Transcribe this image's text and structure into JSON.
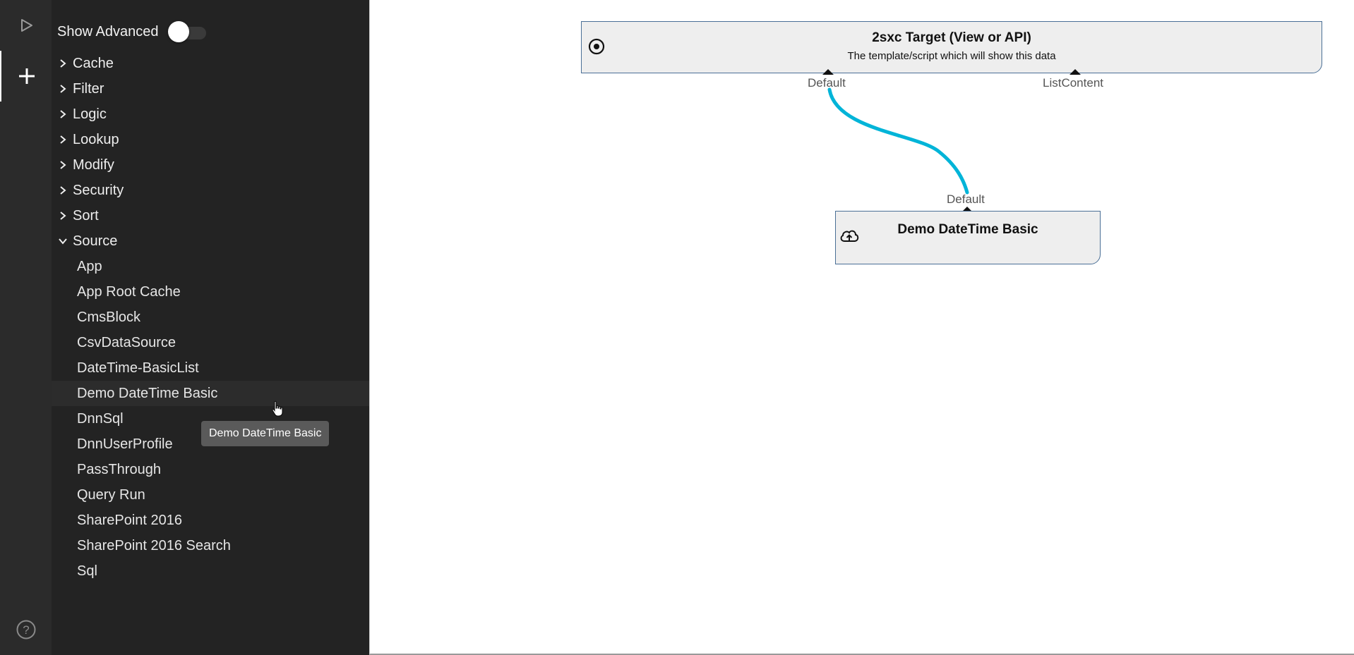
{
  "sidebar": {
    "show_advanced_label": "Show Advanced",
    "show_advanced_on": false,
    "categories": [
      {
        "label": "Cache",
        "expanded": false
      },
      {
        "label": "Filter",
        "expanded": false
      },
      {
        "label": "Logic",
        "expanded": false
      },
      {
        "label": "Lookup",
        "expanded": false
      },
      {
        "label": "Modify",
        "expanded": false
      },
      {
        "label": "Security",
        "expanded": false
      },
      {
        "label": "Sort",
        "expanded": false
      },
      {
        "label": "Source",
        "expanded": true
      }
    ],
    "source_items": [
      "App",
      "App Root Cache",
      "CmsBlock",
      "CsvDataSource",
      "DateTime-BasicList",
      "Demo DateTime Basic",
      "DnnSql",
      "DnnUserProfile",
      "PassThrough",
      "Query Run",
      "SharePoint 2016",
      "SharePoint 2016 Search",
      "Sql"
    ],
    "hovered_item": "Demo DateTime Basic",
    "tooltip": "Demo DateTime Basic"
  },
  "rail": {
    "icons": [
      "play-icon",
      "plus-icon",
      "help-icon"
    ]
  },
  "canvas": {
    "target_node": {
      "title": "2sxc Target (View or API)",
      "description": "The template/script which will show this data",
      "icon": "target-icon",
      "in_ports": [
        "Default",
        "ListContent"
      ]
    },
    "source_node": {
      "title": "Demo DateTime Basic",
      "icon": "cloud-upload-icon",
      "out_ports": [
        "Default"
      ]
    },
    "connection_color": "#00b4d8"
  }
}
